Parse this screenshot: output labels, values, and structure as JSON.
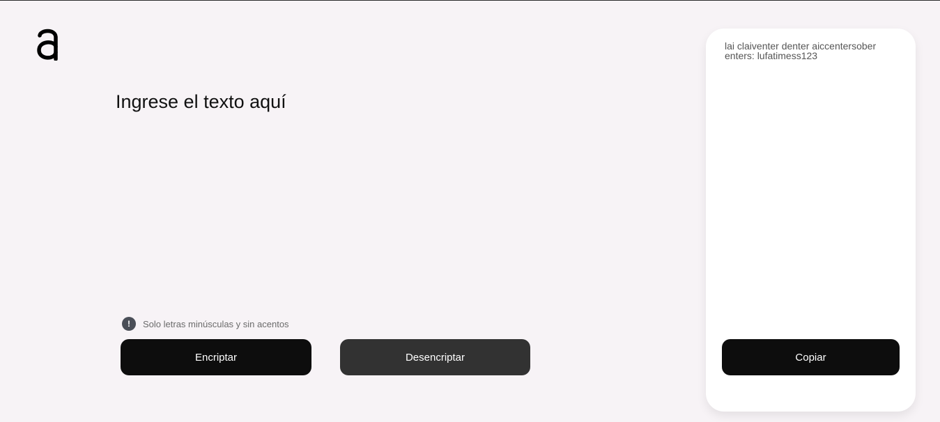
{
  "input": {
    "placeholder": "Ingrese el texto aquí",
    "value": ""
  },
  "hint": {
    "icon": "exclamation-circle-icon",
    "icon_glyph": "!",
    "text": "Solo letras minúsculas y sin acentos"
  },
  "buttons": {
    "encrypt": "Encriptar",
    "decrypt": "Desencriptar",
    "copy": "Copiar"
  },
  "output": {
    "text": "lai claiventer denter aiccentersober enters: lufatimess123"
  },
  "colors": {
    "background": "#f7f3f6",
    "primary_button": "#0d0d0d",
    "secondary_button": "#323232",
    "panel": "#ffffff"
  }
}
